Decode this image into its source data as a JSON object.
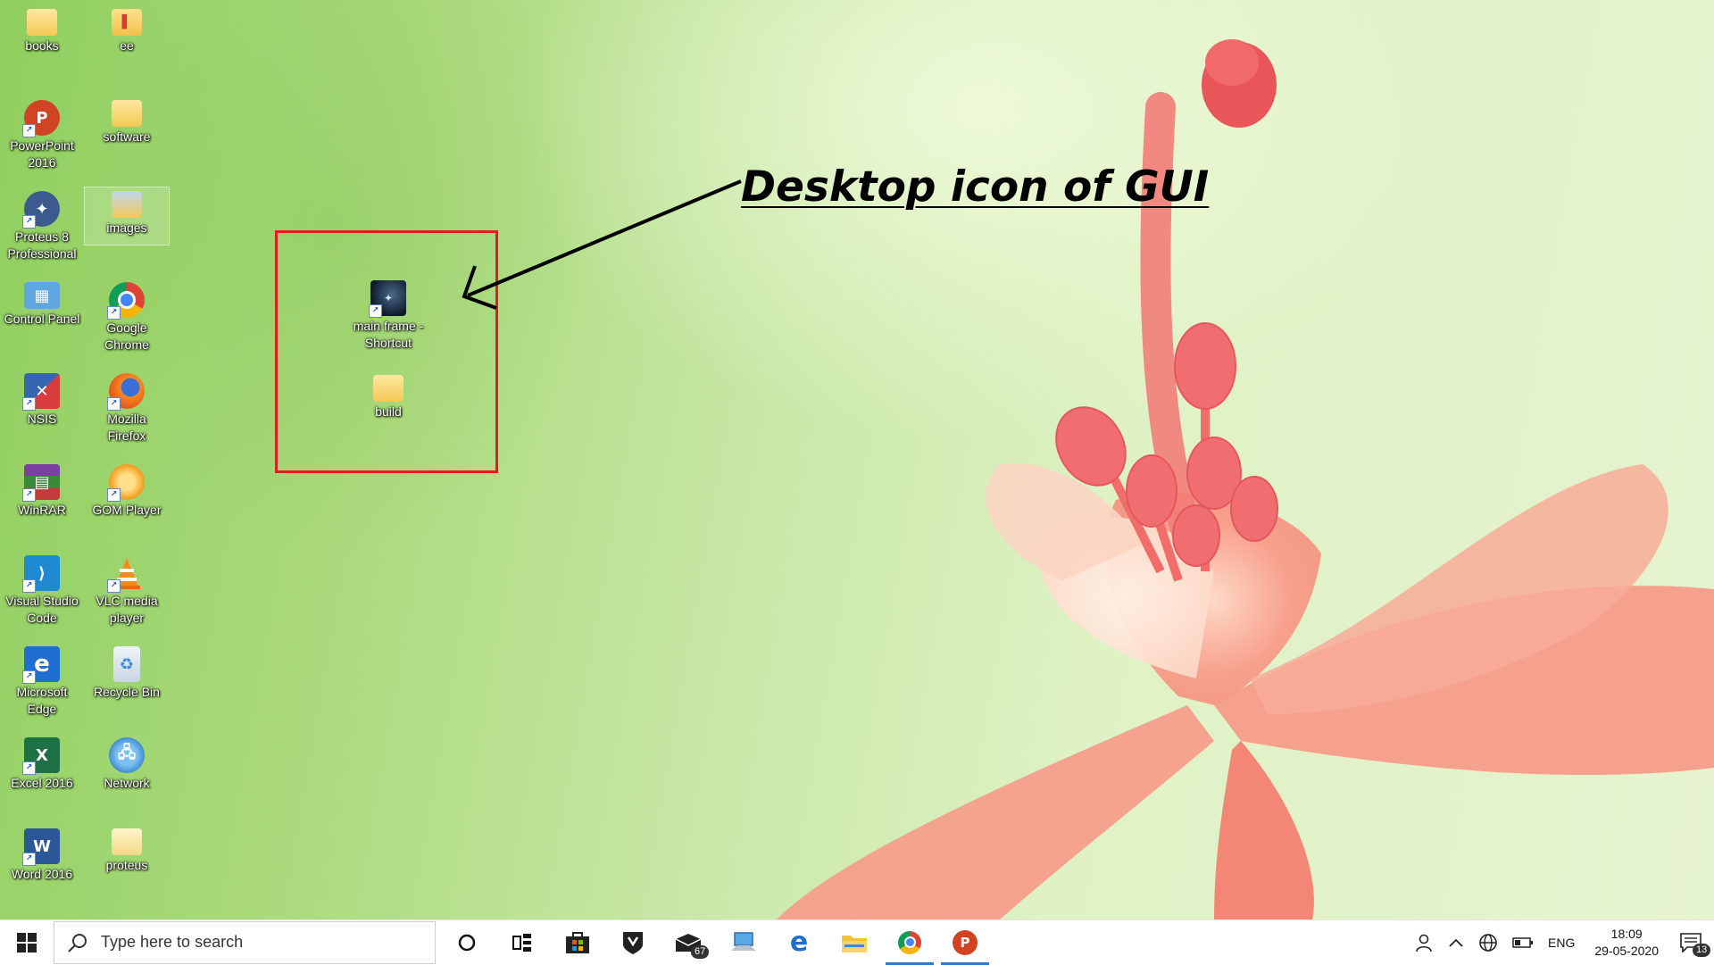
{
  "desktop": {
    "icons": [
      {
        "label": "books",
        "icon": "folder-icon"
      },
      {
        "label": "ee",
        "icon": "folder-icon"
      },
      {
        "label": "PowerPoint 2016",
        "icon": "powerpoint-icon"
      },
      {
        "label": "software",
        "icon": "folder-icon"
      },
      {
        "label": "Proteus 8 Professional",
        "icon": "proteus-icon"
      },
      {
        "label": "images",
        "icon": "folder-icon"
      },
      {
        "label": "Control Panel",
        "icon": "control-panel-icon"
      },
      {
        "label": "Google Chrome",
        "icon": "chrome-icon"
      },
      {
        "label": "NSIS",
        "icon": "nsis-icon"
      },
      {
        "label": "Mozilla Firefox",
        "icon": "firefox-icon"
      },
      {
        "label": "WinRAR",
        "icon": "winrar-icon"
      },
      {
        "label": "GOM Player",
        "icon": "gom-player-icon"
      },
      {
        "label": "Visual Studio Code",
        "icon": "vscode-icon"
      },
      {
        "label": "VLC media player",
        "icon": "vlc-icon"
      },
      {
        "label": "Microsoft Edge",
        "icon": "edge-icon"
      },
      {
        "label": "Recycle Bin",
        "icon": "recycle-bin-icon"
      },
      {
        "label": "Excel 2016",
        "icon": "excel-icon"
      },
      {
        "label": "Network",
        "icon": "network-icon"
      },
      {
        "label": "Word 2016",
        "icon": "word-icon"
      },
      {
        "label": "proteus",
        "icon": "folder-icon"
      }
    ],
    "highlighted_icons": [
      {
        "label": "main frame - Shortcut",
        "icon": "app-shortcut-icon"
      },
      {
        "label": "build",
        "icon": "folder-icon"
      }
    ],
    "selected_icon": "images",
    "annotation": {
      "text": "Desktop icon of GUI",
      "box_color": "#e41b23"
    }
  },
  "taskbar": {
    "search_placeholder": "Type here to search",
    "pinned": [
      {
        "name": "cortana",
        "icon": "cortana-circle-icon"
      },
      {
        "name": "task-view",
        "icon": "task-view-icon"
      },
      {
        "name": "store",
        "icon": "store-icon"
      },
      {
        "name": "security",
        "icon": "shield-icon"
      },
      {
        "name": "mail",
        "icon": "mail-icon",
        "badge": "67"
      },
      {
        "name": "this-pc",
        "icon": "computer-icon"
      },
      {
        "name": "edge",
        "icon": "edge-icon"
      },
      {
        "name": "file-explorer",
        "icon": "folder-icon"
      },
      {
        "name": "chrome",
        "icon": "chrome-icon",
        "active": true
      },
      {
        "name": "powerpoint",
        "icon": "powerpoint-icon",
        "active": true
      }
    ],
    "tray": {
      "language": "ENG",
      "time": "18:09",
      "date": "29-05-2020",
      "notifications": "13"
    },
    "colors": {
      "accent": "#2e7bd6"
    }
  }
}
